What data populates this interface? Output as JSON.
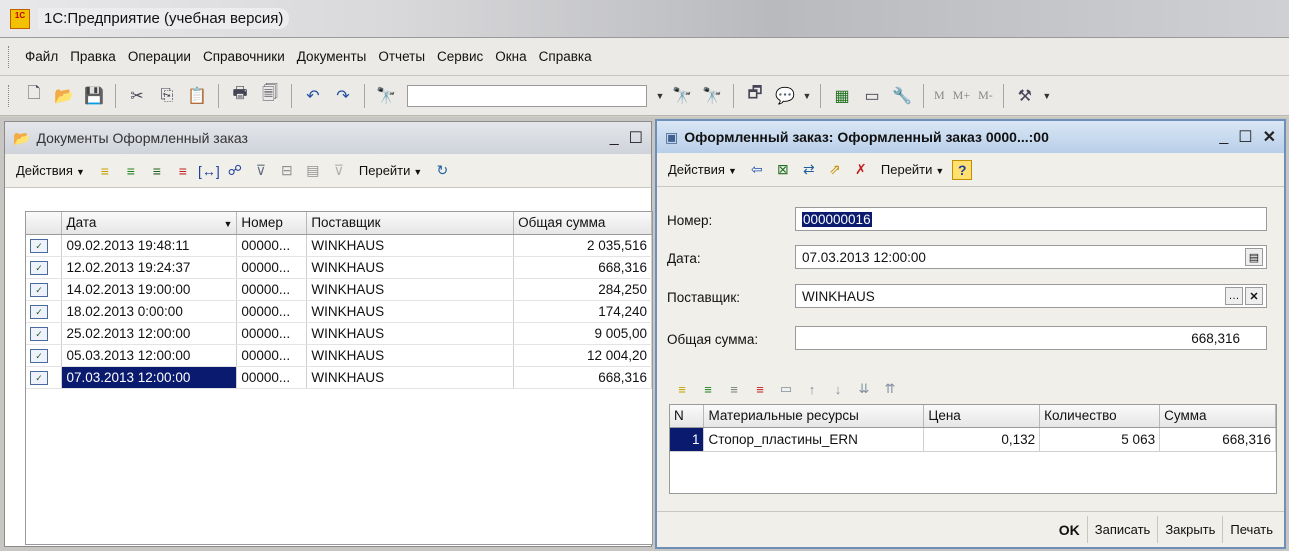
{
  "app": {
    "title": "1С:Предприятие (учебная версия)",
    "logo_text": "1С"
  },
  "menu": [
    "Файл",
    "Правка",
    "Операции",
    "Справочники",
    "Документы",
    "Отчеты",
    "Сервис",
    "Окна",
    "Справка"
  ],
  "toolbar": {
    "search_value": "",
    "memory_buttons": [
      "M",
      "M+",
      "M-"
    ]
  },
  "list_window": {
    "title": "Документы Оформленный заказ",
    "actions_label": "Действия",
    "goto_label": "Перейти",
    "columns": [
      "Дата",
      "Номер",
      "Поставщик",
      "Общая сумма"
    ],
    "rows": [
      {
        "date": "09.02.2013 19:48:11",
        "number": "00000...",
        "supplier": "WINKHAUS",
        "sum": "2 035,516"
      },
      {
        "date": "12.02.2013 19:24:37",
        "number": "00000...",
        "supplier": "WINKHAUS",
        "sum": "668,316"
      },
      {
        "date": "14.02.2013 19:00:00",
        "number": "00000...",
        "supplier": "WINKHAUS",
        "sum": "284,250"
      },
      {
        "date": "18.02.2013 0:00:00",
        "number": "00000...",
        "supplier": "WINKHAUS",
        "sum": "174,240"
      },
      {
        "date": "25.02.2013 12:00:00",
        "number": "00000...",
        "supplier": "WINKHAUS",
        "sum": "9 005,00"
      },
      {
        "date": "05.03.2013 12:00:00",
        "number": "00000...",
        "supplier": "WINKHAUS",
        "sum": "12 004,20"
      },
      {
        "date": "07.03.2013 12:00:00",
        "number": "00000...",
        "supplier": "WINKHAUS",
        "sum": "668,316"
      }
    ],
    "selected_row": 6
  },
  "doc_window": {
    "title": "Оформленный заказ: Оформленный заказ 0000...:00",
    "actions_label": "Действия",
    "goto_label": "Перейти",
    "help_label": "?",
    "fields": {
      "number_label": "Номер:",
      "number_value": "000000016",
      "date_label": "Дата:",
      "date_value": "07.03.2013 12:00:00",
      "supplier_label": "Поставщик:",
      "supplier_value": "WINKHAUS",
      "total_label": "Общая сумма:",
      "total_value": "668,316"
    },
    "table": {
      "columns": [
        "N",
        "Материальные ресурсы",
        "Цена",
        "Количество",
        "Сумма"
      ],
      "rows": [
        {
          "n": "1",
          "resource": "Стопор_пластины_ERN",
          "price": "0,132",
          "qty": "5 063",
          "sum": "668,316"
        }
      ]
    },
    "buttons": {
      "ok": "OK",
      "save": "Записать",
      "close": "Закрыть",
      "print": "Печать"
    }
  }
}
